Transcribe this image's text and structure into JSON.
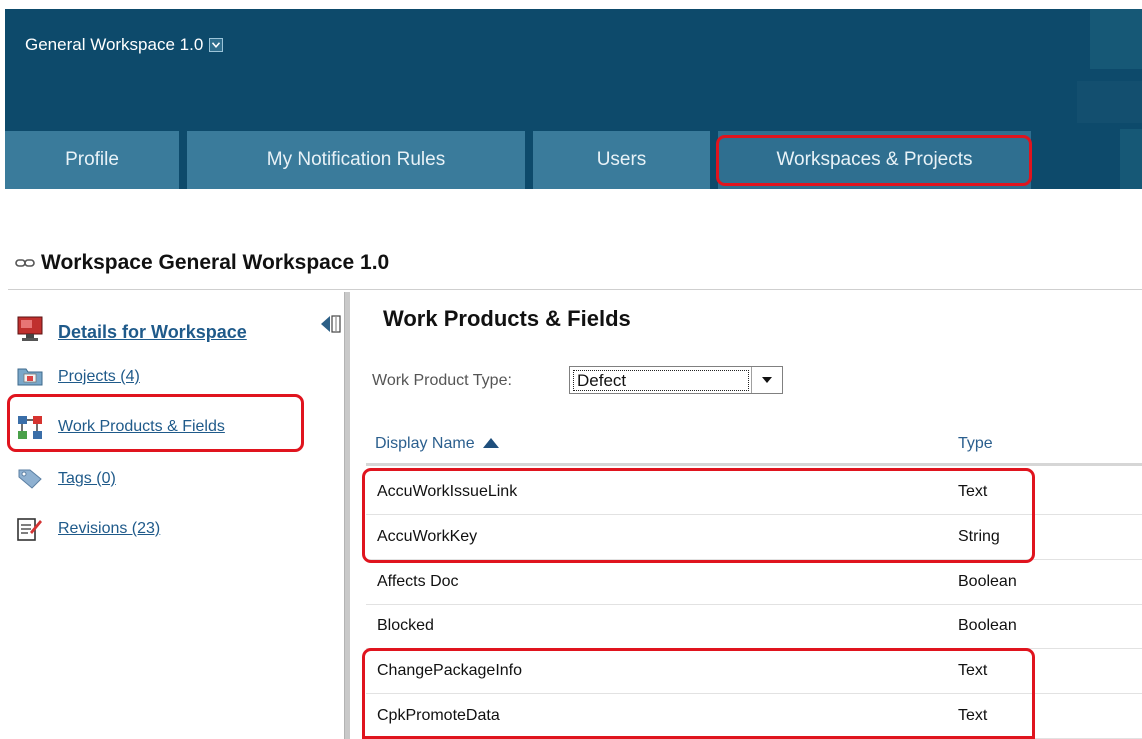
{
  "workspace": {
    "title": "General Workspace 1.0",
    "dropdown_icon": "chevron-down-icon"
  },
  "tabs": [
    {
      "label": "Profile"
    },
    {
      "label": "My Notification Rules"
    },
    {
      "label": "Users"
    },
    {
      "label": "Workspaces & Projects",
      "active": true
    }
  ],
  "page": {
    "title": "Workspace General Workspace 1.0",
    "title_icon": "link-icon"
  },
  "sidebar": {
    "items": [
      {
        "label": "Details for Workspace",
        "icon": "workspace-monitor-icon"
      },
      {
        "label": "Projects (4)",
        "icon": "folder-icon"
      },
      {
        "label": "Work Products & Fields",
        "icon": "hierarchy-icon"
      },
      {
        "label": "Tags (0)",
        "icon": "tag-icon"
      },
      {
        "label": "Revisions (23)",
        "icon": "edit-document-icon"
      }
    ],
    "collapse_icon": "collapse-left-icon"
  },
  "main": {
    "section_title": "Work Products & Fields",
    "work_product_type": {
      "label": "Work Product Type:",
      "value": "Defect"
    },
    "table": {
      "columns": [
        "Display Name",
        "Type"
      ],
      "sort_icon": "sort-ascending-icon",
      "rows": [
        {
          "name": "AccuWorkIssueLink",
          "type": "Text"
        },
        {
          "name": "AccuWorkKey",
          "type": "String"
        },
        {
          "name": "Affects Doc",
          "type": "Boolean"
        },
        {
          "name": "Blocked",
          "type": "Boolean"
        },
        {
          "name": "ChangePackageInfo",
          "type": "Text"
        },
        {
          "name": "CpkPromoteData",
          "type": "Text"
        }
      ]
    }
  },
  "colors": {
    "header_bg": "#0d4a6b",
    "tab_bg": "#3a7b9b",
    "highlight": "#e0141e",
    "link": "#1f5a8a"
  }
}
